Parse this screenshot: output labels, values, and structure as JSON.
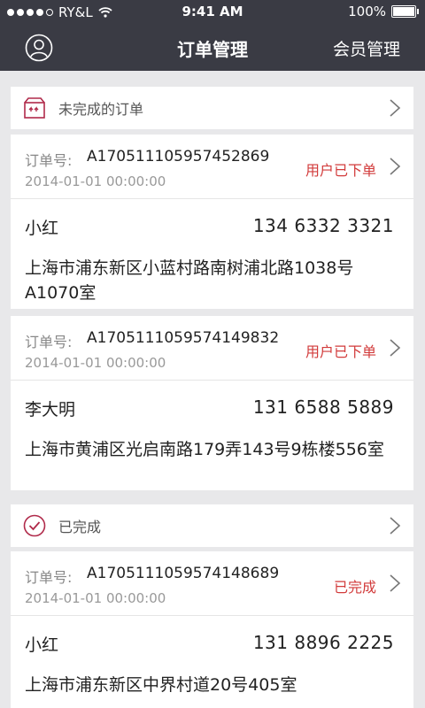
{
  "status_bar": {
    "carrier": "RY&L",
    "time": "9:41 AM",
    "battery": "100%"
  },
  "nav": {
    "title": "订单管理",
    "member_link": "会员管理"
  },
  "sections": {
    "pending": {
      "label": "未完成的订单"
    },
    "done": {
      "label": "已完成"
    }
  },
  "orders": [
    {
      "no_label": "订单号:",
      "no": "A170511105957452869",
      "date": "2014-01-01 00:00:00",
      "status": "用户已下单",
      "name": "小红",
      "phone": "134 6332 3321",
      "address": "上海市浦东新区小蓝村路南树浦北路1038号A1070室"
    },
    {
      "no_label": "订单号:",
      "no": "A170511105957414983​2",
      "date": "2014-01-01 00:00:00",
      "status": "用户已下单",
      "name": "李大明",
      "phone": "131 6588 5889",
      "address": "上海市黄浦区光启南路179弄143号9栋楼556室"
    },
    {
      "no_label": "订单号:",
      "no": "A170511105957414868​9",
      "date": "2014-01-01 00:00:00",
      "status": "已完成",
      "name": "小红",
      "phone": "131 8896 2225",
      "address": "上海市浦东新区中界村道20号405室"
    }
  ],
  "colors": {
    "bar": "#3a3b44",
    "background": "#e8e8ea",
    "status_red": "#d23b3b",
    "icon_accent": "#b02a4a"
  }
}
